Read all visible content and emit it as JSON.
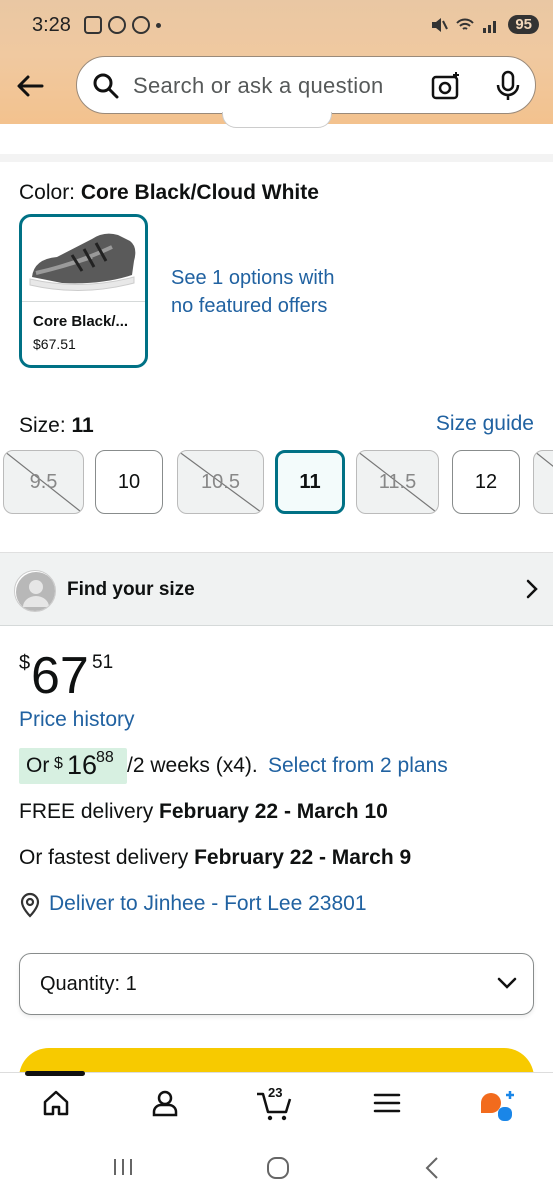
{
  "status_bar": {
    "time": "3:28",
    "battery": "95"
  },
  "search": {
    "placeholder": "Search or ask a question"
  },
  "color": {
    "label": "Color:",
    "value": "Core Black/Cloud White"
  },
  "swatch": {
    "name": "Core Black/...",
    "price": "$67.51"
  },
  "see_options": "See 1 options with no featured offers",
  "size": {
    "label": "Size:",
    "value": "11",
    "guide": "Size guide",
    "options": [
      {
        "label": "9.5",
        "available": false
      },
      {
        "label": "10",
        "available": true
      },
      {
        "label": "10.5",
        "available": false
      },
      {
        "label": "11",
        "available": true,
        "selected": true
      },
      {
        "label": "11.5",
        "available": false
      },
      {
        "label": "12",
        "available": true
      }
    ]
  },
  "find_size": "Find your size",
  "price": {
    "currency": "$",
    "whole": "67",
    "fraction": "51"
  },
  "price_history": "Price history",
  "installment": {
    "or": "Or",
    "currency": "$",
    "whole": "16",
    "fraction": "88",
    "period": "/2 weeks (x4).",
    "plans_link": "Select from 2 plans"
  },
  "delivery": {
    "free_prefix": "FREE delivery",
    "free_dates": "February 22 - March 10",
    "fast_prefix": "Or fastest delivery",
    "fast_dates": "February 22 - March 9"
  },
  "deliver_to": "Deliver to Jinhee - Fort Lee 23801",
  "quantity": "Quantity: 1",
  "nav": {
    "cart_count": "23"
  },
  "colors": {
    "link": "#2162a1",
    "accent": "#007185",
    "buy": "#f7ca00",
    "ai": "#f26b1d"
  }
}
